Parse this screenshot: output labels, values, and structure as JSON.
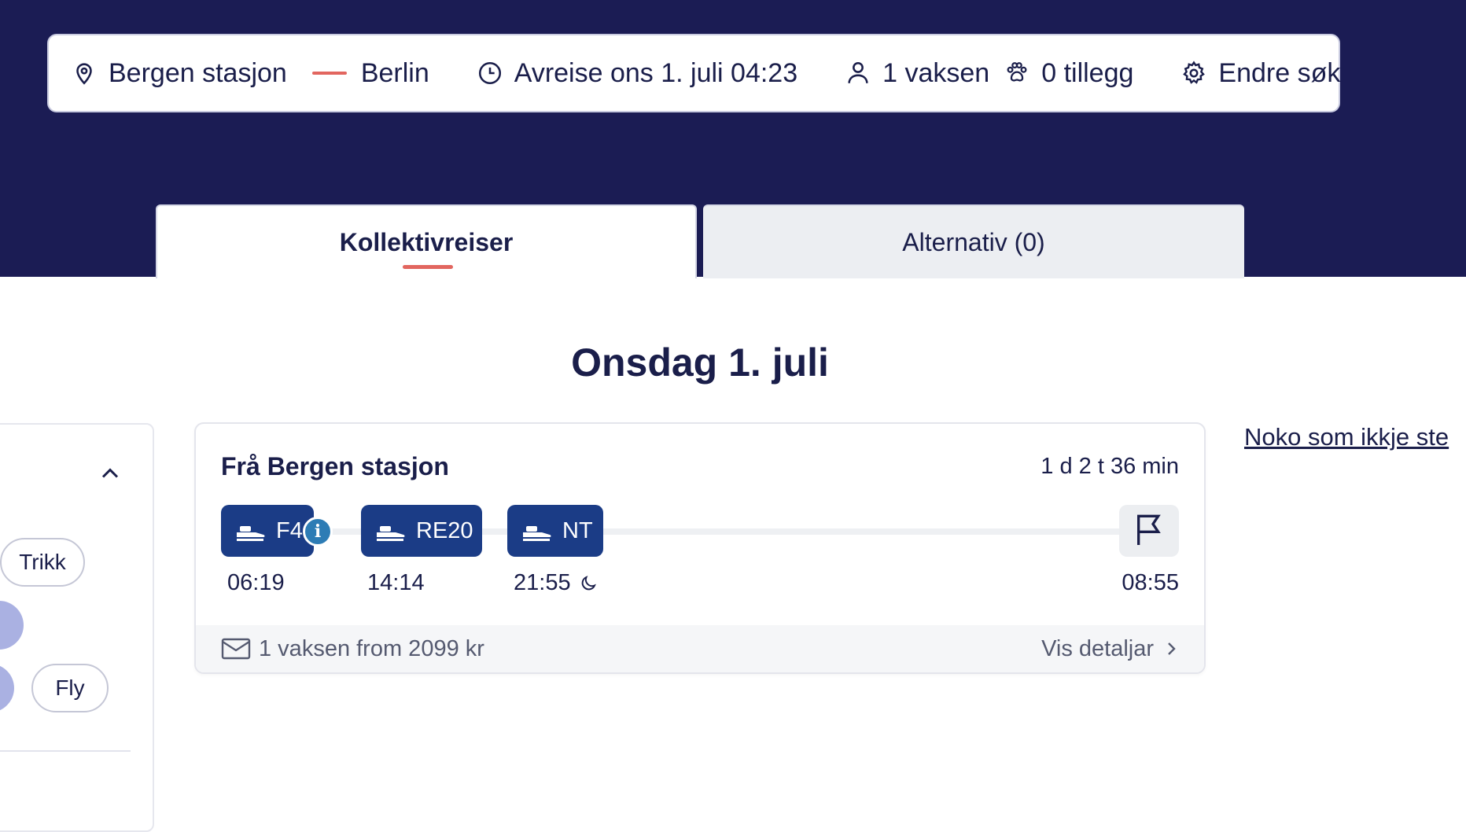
{
  "search": {
    "from": "Bergen stasjon",
    "to": "Berlin",
    "departure": "Avreise ons 1. juli 04:23",
    "travelers": "1 vaksen",
    "extras": "0 tillegg",
    "change_search": "Endre søk"
  },
  "tabs": [
    {
      "label": "Kollektivreiser",
      "active": true
    },
    {
      "label": "Alternativ (0)",
      "active": false
    }
  ],
  "date_heading": "Onsdag 1. juli",
  "filters": {
    "chips": [
      "Trikk",
      "Fly"
    ]
  },
  "trip": {
    "from_label": "Frå Bergen stasjon",
    "duration": "1 d 2 t 36 min",
    "legs": [
      {
        "line": "F4",
        "time": "06:19",
        "has_info": true
      },
      {
        "line": "RE20",
        "time": "14:14",
        "has_info": false
      },
      {
        "line": "NT",
        "time": "21:55",
        "night": true
      }
    ],
    "arrival_time": "08:55",
    "price": "1 vaksen from 2099 kr",
    "details_label": "Vis detaljar"
  },
  "side_link": "Noko som ikkje ste",
  "colors": {
    "header_bg": "#1b1c54",
    "accent": "#e2665f",
    "leg_bg": "#1b3c86",
    "info_badge": "#2d7cb5",
    "chip_selected": "#aab1e2"
  },
  "icons": [
    "location-pin-icon",
    "clock-icon",
    "person-icon",
    "paw-icon",
    "gear-icon",
    "chevron-up-icon",
    "train-icon",
    "info-icon",
    "flag-icon",
    "moon-icon",
    "ticket-icon",
    "chevron-right-icon"
  ]
}
